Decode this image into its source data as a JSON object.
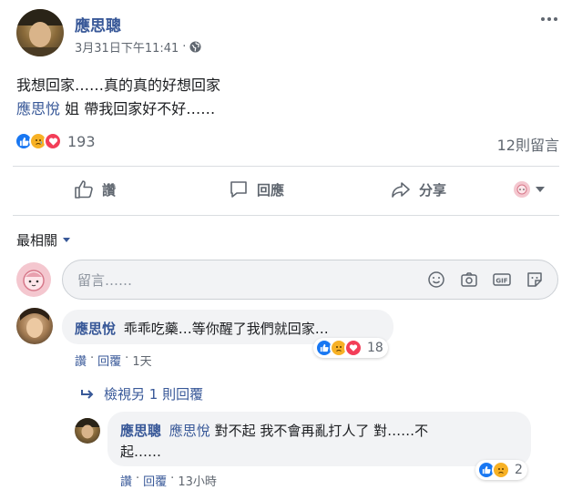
{
  "post": {
    "author": "應思聰",
    "timestamp": "3月31日下午11:41",
    "separator": "·",
    "text_line1": "我想回家……真的真的好想回家",
    "mention": "應思悅",
    "text_line2": " 姐 帶我回家好不好……",
    "reaction_count": "193",
    "comment_count": "12則留言"
  },
  "actions": {
    "like": "讚",
    "comment": "回應",
    "share": "分享"
  },
  "sort": {
    "label": "最相關"
  },
  "composer": {
    "placeholder": "留言……"
  },
  "comments": [
    {
      "author": "應思悅",
      "text": "乖乖吃藥…等你醒了我們就回家…",
      "like": "讚",
      "reply": "回覆",
      "time": "1天",
      "reaction_count": "18",
      "view_replies": "檢視另 1 則回覆"
    }
  ],
  "reply": {
    "author": "應思聰",
    "mention": "應思悅",
    "text_line1": " 對不起 我不會再亂打人了 對……不",
    "text_line2": "起……",
    "like": "讚",
    "reply": "回覆",
    "time": "13小時",
    "reaction_count": "2"
  },
  "colors": {
    "link": "#385898",
    "like_blue": "#1877f2",
    "sad_yellow": "#f7b125",
    "love_red": "#f33e58"
  }
}
